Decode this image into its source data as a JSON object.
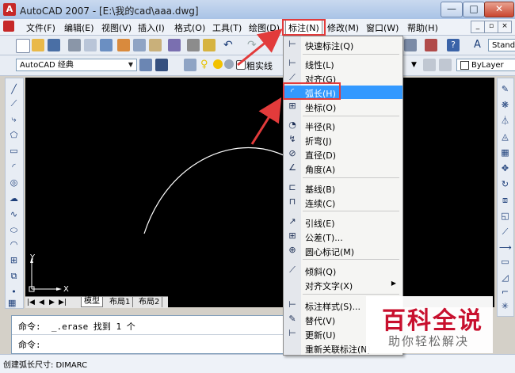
{
  "window": {
    "title": "AutoCAD 2007 - [E:\\我的cad\\aaa.dwg]",
    "controls": {
      "minimize": "—",
      "maximize": "□",
      "close": "✕"
    }
  },
  "menubar": {
    "items": [
      {
        "label": "文件(F)"
      },
      {
        "label": "编辑(E)"
      },
      {
        "label": "视图(V)"
      },
      {
        "label": "插入(I)"
      },
      {
        "label": "格式(O)"
      },
      {
        "label": "工具(T)"
      },
      {
        "label": "绘图(D)"
      },
      {
        "label": "标注(N)"
      },
      {
        "label": "修改(M)"
      },
      {
        "label": "窗口(W)"
      },
      {
        "label": "帮助(H)"
      }
    ],
    "active_index": 7
  },
  "toolbar2": {
    "workspace_combo": "AutoCAD 经典",
    "linetype_fragment": "粗实线",
    "bylayer_combo": "ByLayer"
  },
  "toolbar1": {
    "text_style_fragment": "Stand"
  },
  "dropdown": {
    "items": [
      {
        "label": "快速标注(Q)",
        "icon": "quick-dimension-icon"
      },
      {
        "label": "线性(L)",
        "icon": "linear-dimension-icon"
      },
      {
        "label": "对齐(G)",
        "icon": "aligned-dimension-icon"
      },
      {
        "label": "弧长(H)",
        "icon": "arc-length-icon"
      },
      {
        "label": "坐标(O)",
        "icon": "ordinate-icon"
      },
      {
        "label": "半径(R)",
        "icon": "radius-icon"
      },
      {
        "label": "折弯(J)",
        "icon": "jogged-icon"
      },
      {
        "label": "直径(D)",
        "icon": "diameter-icon"
      },
      {
        "label": "角度(A)",
        "icon": "angular-icon"
      },
      {
        "label": "基线(B)",
        "icon": "baseline-icon"
      },
      {
        "label": "连续(C)",
        "icon": "continue-icon"
      },
      {
        "label": "引线(E)",
        "icon": "leader-icon"
      },
      {
        "label": "公差(T)...",
        "icon": "tolerance-icon"
      },
      {
        "label": "圆心标记(M)",
        "icon": "center-mark-icon"
      },
      {
        "label": "倾斜(Q)",
        "icon": "oblique-icon"
      },
      {
        "label": "对齐文字(X)",
        "icon": ""
      },
      {
        "label": "标注样式(S)...",
        "icon": "dim-style-icon"
      },
      {
        "label": "替代(V)",
        "icon": "override-icon"
      },
      {
        "label": "更新(U)",
        "icon": "update-icon"
      },
      {
        "label": "重新关联标注(N)",
        "icon": ""
      }
    ],
    "highlighted_index": 3
  },
  "layout_tabs": {
    "model": "模型",
    "layout1": "布局1",
    "layout2": "布局2"
  },
  "ucs": {
    "x": "X",
    "y": "Y"
  },
  "command": {
    "line1": "命令:  _.erase 找到 1 个",
    "line2": "命令:"
  },
  "status": {
    "text": "创建弧长尺寸: DIMARC"
  },
  "watermark": {
    "title": "百科全说",
    "subtitle": "助你轻松解决"
  },
  "colors": {
    "highlight": "#3399ff",
    "annotation_red": "#e23b3b",
    "watermark_red": "#c8102e"
  }
}
